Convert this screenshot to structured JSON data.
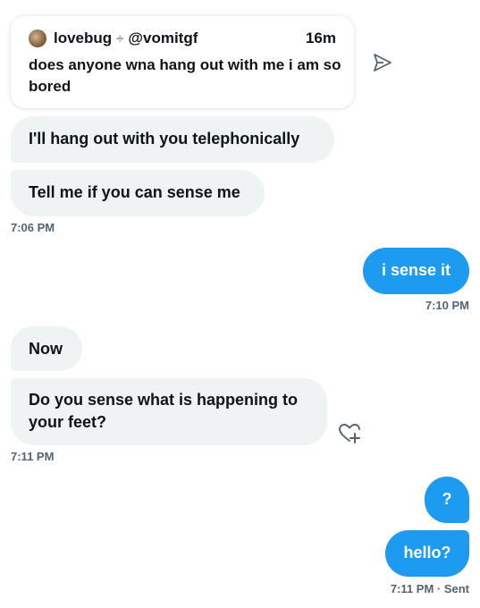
{
  "quoted_post": {
    "display_name": "lovebug",
    "separator": "÷",
    "handle": "@vomitgf",
    "time_ago": "16m",
    "text": "does anyone wna hang out with me i am so bored"
  },
  "messages": [
    {
      "id": "m1",
      "direction": "received",
      "text": "I'll hang out with you telephonically"
    },
    {
      "id": "m2",
      "direction": "received",
      "text": "Tell me if you can sense me"
    },
    {
      "id": "m3",
      "direction": "sent",
      "text": "i sense it"
    },
    {
      "id": "m4",
      "direction": "received",
      "text": "Now"
    },
    {
      "id": "m5",
      "direction": "received",
      "text": "Do you sense what is happening to your feet?"
    },
    {
      "id": "m6",
      "direction": "sent",
      "text": "?"
    },
    {
      "id": "m7",
      "direction": "sent",
      "text": "hello?"
    }
  ],
  "timestamps": {
    "t1": "7:06 PM",
    "t2": "7:10 PM",
    "t3": "7:11 PM",
    "t4": "7:11 PM · Sent"
  },
  "icons": {
    "share": "share-send-icon",
    "react": "add-reaction-heart-icon"
  },
  "colors": {
    "sent_bubble": "#1d9bf0",
    "received_bubble": "#eff3f4",
    "text": "#0f1419",
    "secondary_text": "#536471"
  }
}
